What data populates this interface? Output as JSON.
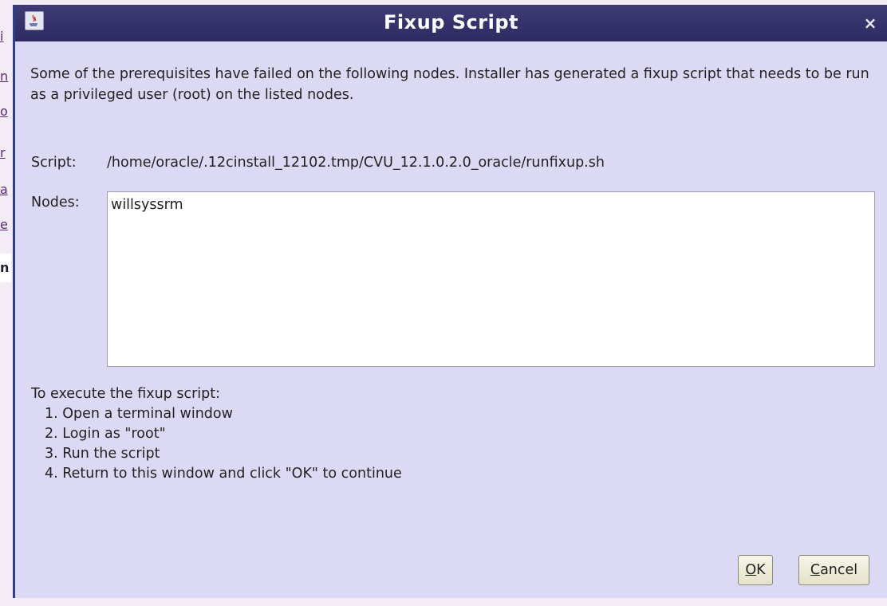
{
  "background_window": {
    "fragments": [
      "i",
      "n",
      "o",
      "r",
      "a",
      "e",
      "n"
    ]
  },
  "dialog": {
    "title": "Fixup Script",
    "close_label": "×",
    "message": "Some of the prerequisites have failed on the following nodes. Installer has generated a fixup script that needs to be run as a privileged user (root) on the listed nodes.",
    "script_label": "Script:",
    "script_path": "/home/oracle/.12cinstall_12102.tmp/CVU_12.1.0.2.0_oracle/runfixup.sh",
    "nodes_label": "Nodes:",
    "nodes_value": "willsyssrm",
    "instructions_heading": "To execute the fixup script:",
    "steps": [
      "1. Open a terminal window",
      "2. Login as \"root\"",
      "3. Run the script",
      "4. Return to this window and click \"OK\" to continue"
    ],
    "ok_button": {
      "mnemonic": "O",
      "rest": "K"
    },
    "cancel_button": {
      "mnemonic": "C",
      "rest": "ancel"
    }
  },
  "colors": {
    "titlebar": "#2e2a62",
    "dialog_background": "#dcd9f4",
    "button_background": "#efedd8"
  },
  "icons": {
    "title_icon": "java-app-icon",
    "close_icon": "close-icon"
  }
}
